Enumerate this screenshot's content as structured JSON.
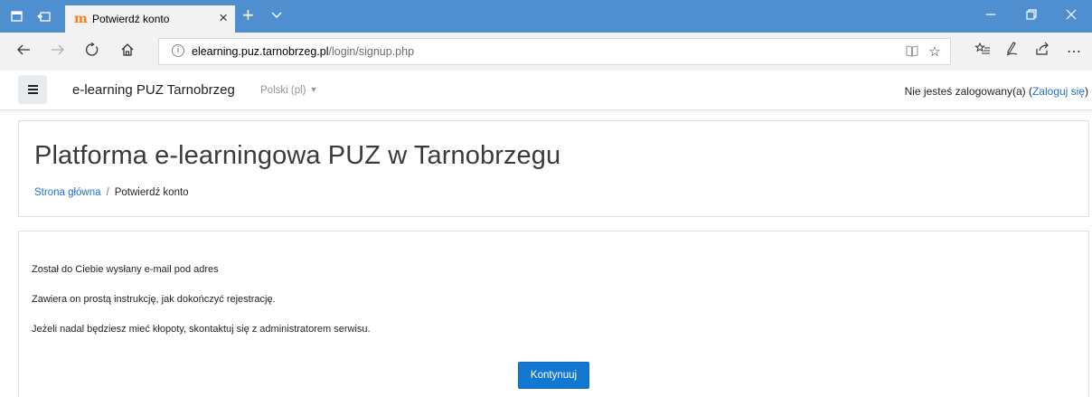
{
  "browser": {
    "tab_title": "Potwierdź konto",
    "tab_favicon": "moodle-favicon",
    "url_host": "elearning.puz.tarnobrzeg.pl",
    "url_path": "/login/signup.php",
    "accent_color": "#4f8fd0"
  },
  "site": {
    "name": "e-learning PUZ Tarnobrzeg",
    "language": "Polski (pl)",
    "login_status": "Nie jesteś zalogowany(a) (",
    "login_link": "Zaloguj się",
    "login_close": ")"
  },
  "header": {
    "title": "Platforma e-learningowa PUZ w Tarnobrzegu",
    "breadcrumb_home": "Strona główna",
    "breadcrumb_sep": "/",
    "breadcrumb_current": "Potwierdź konto"
  },
  "main": {
    "line1": "Został do Ciebie wysłany e-mail pod adres",
    "line2": "Zawiera on prostą instrukcję, jak dokończyć rejestrację.",
    "line3": "Jeżeli nadal będziesz mieć kłopoty, skontaktuj się z administratorem serwisu.",
    "continue_label": "Kontynuuj",
    "button_color": "#1177d1"
  }
}
